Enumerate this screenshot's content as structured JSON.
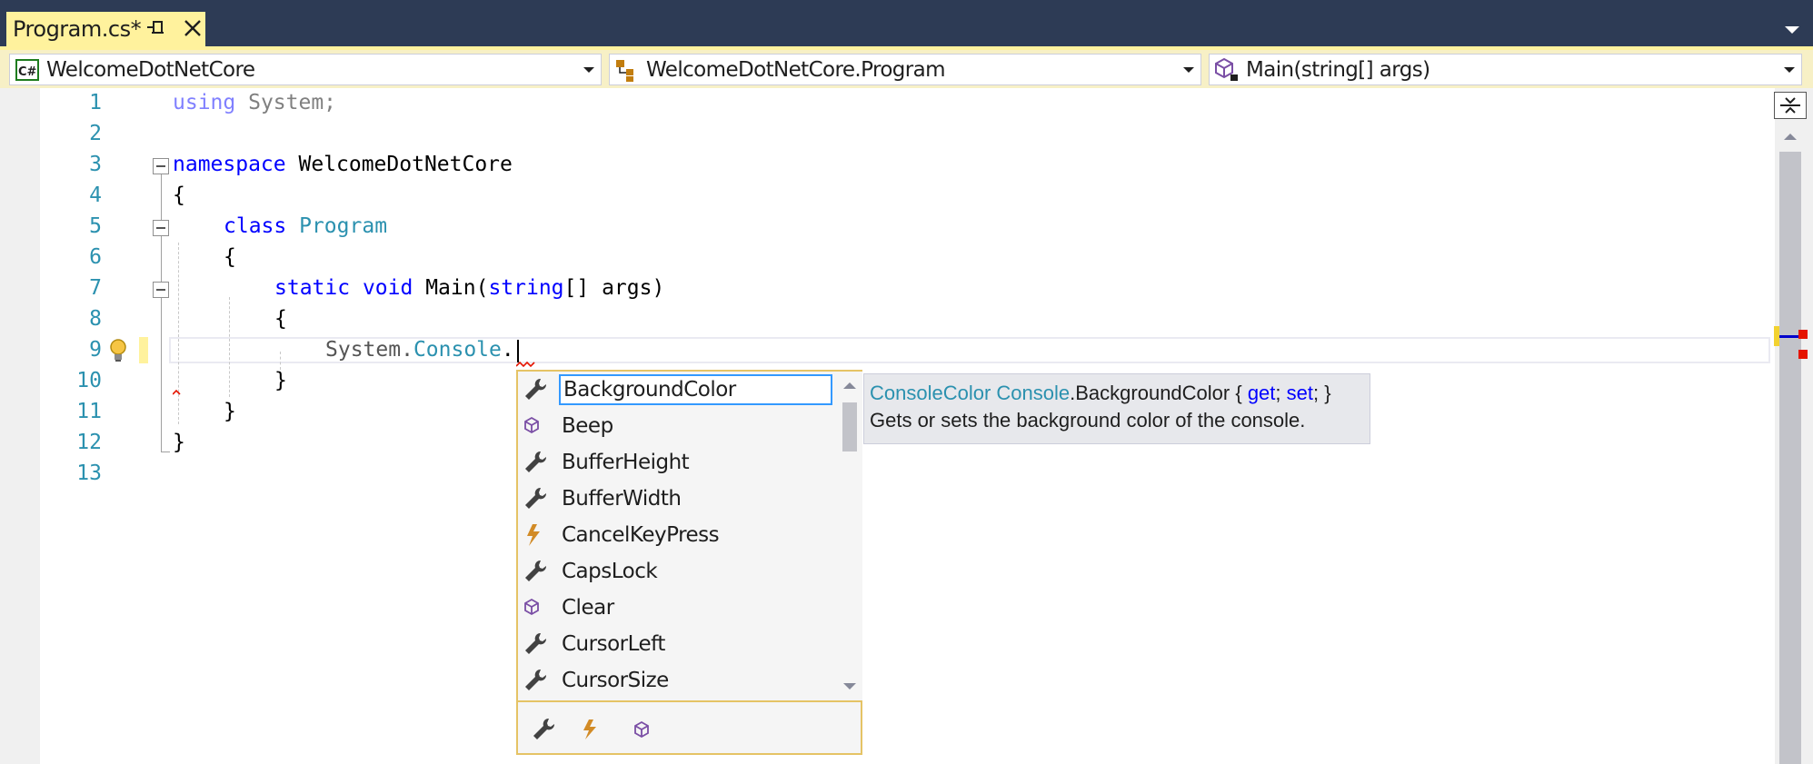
{
  "tab": {
    "title": "Program.cs*"
  },
  "navbar": {
    "project": "WelcomeDotNetCore",
    "type": "WelcomeDotNetCore.Program",
    "member": "Main(string[] args)",
    "project_icon": "csharp-project-icon",
    "type_icon": "class-icon",
    "member_icon": "method-icon"
  },
  "editor": {
    "line_numbers": [
      "1",
      "2",
      "3",
      "4",
      "5",
      "6",
      "7",
      "8",
      "9",
      "10",
      "11",
      "12",
      "13"
    ],
    "lines": {
      "l1_kw": "using",
      "l1_rest": " System;",
      "l3_kw": "namespace",
      "l3_rest": " WelcomeDotNetCore",
      "l4": "{",
      "l5_kw": "class",
      "l5_type": "Program",
      "l6": "{",
      "l7_kw1": "static",
      "l7_kw2": "void",
      "l7_name": " Main(",
      "l7_kw3": "string",
      "l7_rest": "[] args)",
      "l8": "{",
      "l9_a": "System.",
      "l9_type": "Console",
      "l9_b": ".",
      "l10": "}",
      "l11": "}",
      "l12": "}"
    },
    "current_line": 9
  },
  "completion": {
    "items": [
      {
        "label": "BackgroundColor",
        "icon": "property-wrench-icon",
        "selected": true
      },
      {
        "label": "Beep",
        "icon": "method-cube-icon"
      },
      {
        "label": "BufferHeight",
        "icon": "property-wrench-icon"
      },
      {
        "label": "BufferWidth",
        "icon": "property-wrench-icon"
      },
      {
        "label": "CancelKeyPress",
        "icon": "event-lightning-icon"
      },
      {
        "label": "CapsLock",
        "icon": "property-wrench-icon"
      },
      {
        "label": "Clear",
        "icon": "method-cube-icon"
      },
      {
        "label": "CursorLeft",
        "icon": "property-wrench-icon"
      },
      {
        "label": "CursorSize",
        "icon": "property-wrench-icon"
      }
    ],
    "filters": [
      "property-filter-icon",
      "event-filter-icon",
      "method-filter-icon"
    ]
  },
  "quickinfo": {
    "type": "ConsoleColor",
    "owner": " Console",
    "member": ".BackgroundColor { ",
    "get": "get",
    "sep": "; ",
    "set": "set",
    "end": "; }",
    "description": "Gets or sets the background color of the console."
  },
  "colors": {
    "tab_bg": "#2d3b55",
    "active_tab": "#fff29d",
    "keyword": "#0000ff",
    "type": "#2b91af",
    "line_number": "#2b91af",
    "completion_border": "#e5c365"
  }
}
